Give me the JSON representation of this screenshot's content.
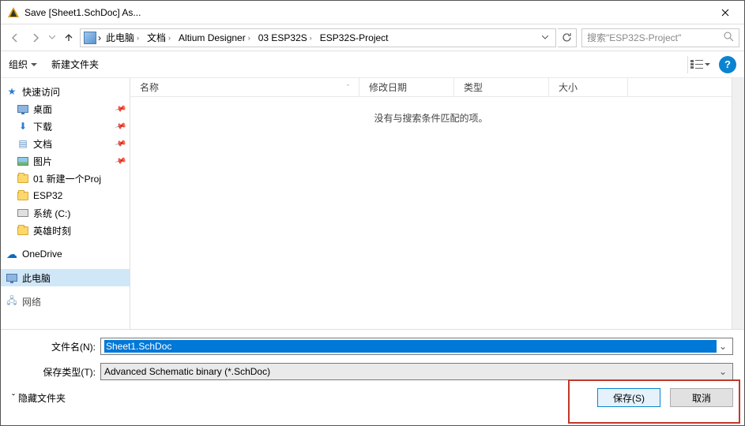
{
  "title": "Save [Sheet1.SchDoc] As...",
  "breadcrumbs": [
    "此电脑",
    "文档",
    "Altium Designer",
    "03 ESP32S",
    "ESP32S-Project"
  ],
  "search_placeholder": "搜索\"ESP32S-Project\"",
  "toolbar": {
    "organize": "组织",
    "new_folder": "新建文件夹"
  },
  "columns": {
    "name": "名称",
    "modified": "修改日期",
    "type": "类型",
    "size": "大小"
  },
  "empty_msg": "没有与搜索条件匹配的项。",
  "sidebar": {
    "quick": "快速访问",
    "desktop": "桌面",
    "downloads": "下载",
    "documents": "文档",
    "pictures": "图片",
    "proj1": "01 新建一个Proj",
    "esp32": "ESP32",
    "system_c": "系统 (C:)",
    "hero": "英雄时刻",
    "onedrive": "OneDrive",
    "thispc": "此电脑",
    "network": "网络"
  },
  "fields": {
    "filename_label": "文件名(N):",
    "filename_value": "Sheet1.SchDoc",
    "filetype_label": "保存类型(T):",
    "filetype_value": "Advanced Schematic binary (*.SchDoc)"
  },
  "footer": {
    "hide_folders": "隐藏文件夹",
    "save": "保存(S)",
    "cancel": "取消"
  }
}
